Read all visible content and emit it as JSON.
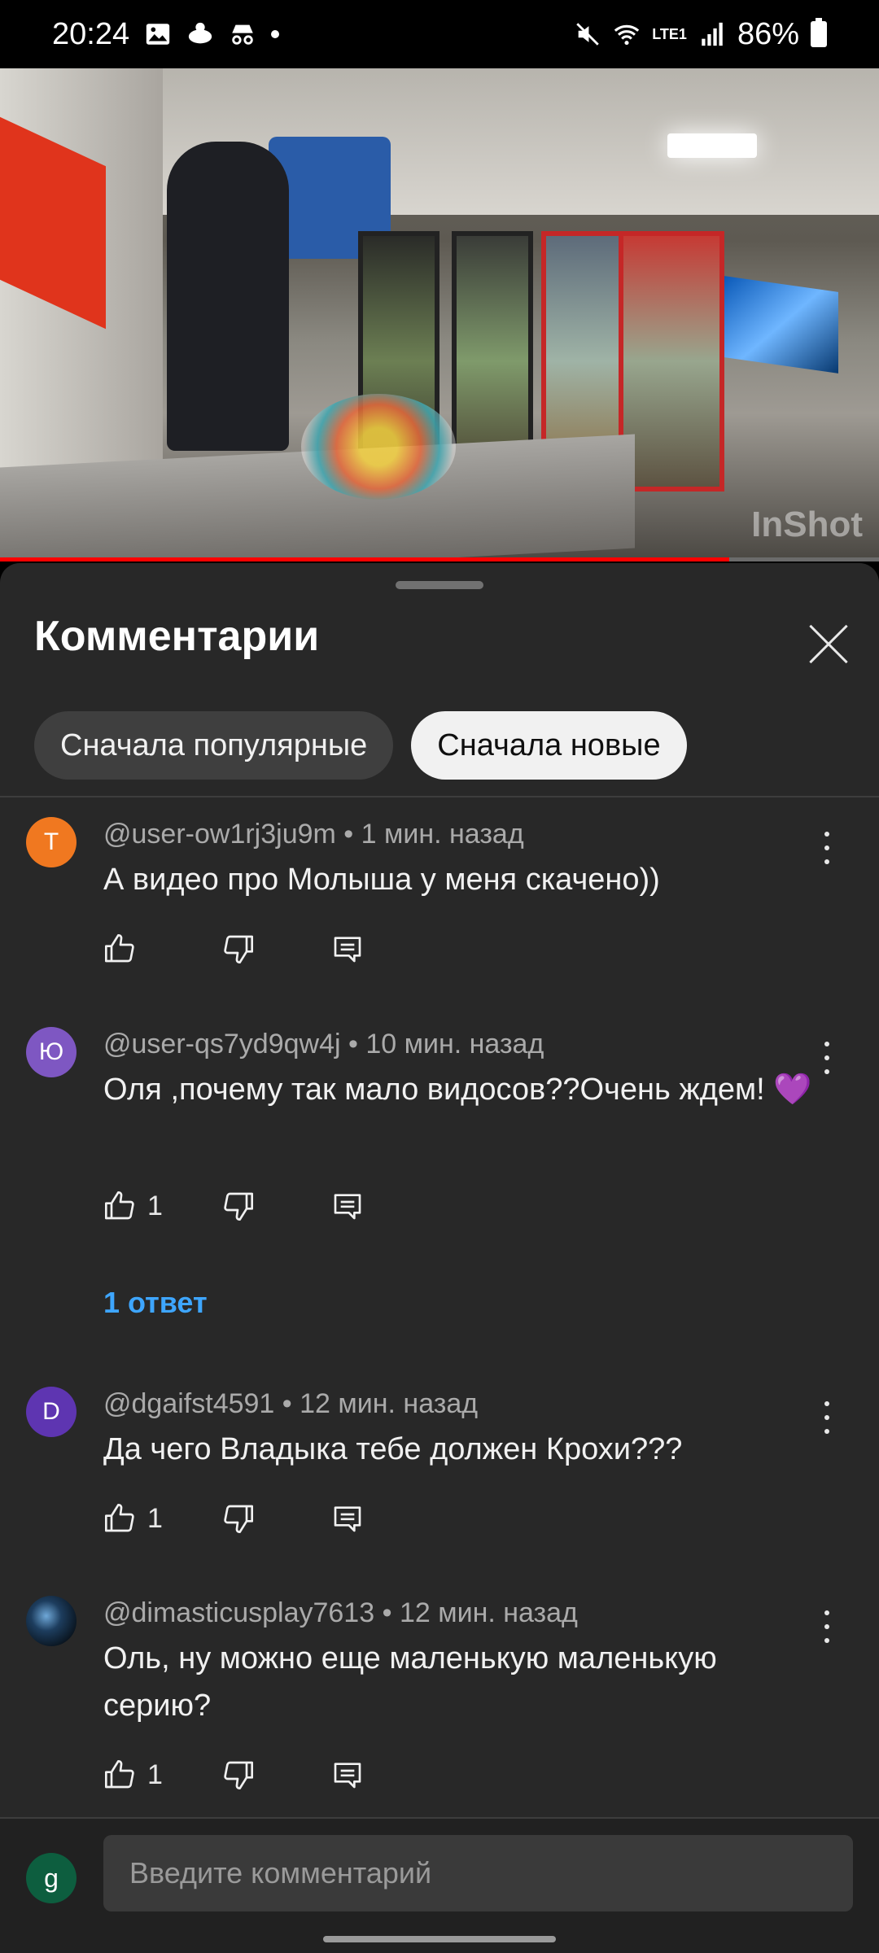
{
  "status_bar": {
    "time": "20:24",
    "battery": "86%",
    "network": "LTE1"
  },
  "video": {
    "watermark": "InShot",
    "progress_fraction": 0.83
  },
  "comments_panel": {
    "title": "Комментарии",
    "sort_chips": [
      {
        "label": "Сначала популярные",
        "selected": false
      },
      {
        "label": "Сначала новые",
        "selected": true
      }
    ],
    "comments": [
      {
        "avatar_letter": "T",
        "avatar_color": "#f07820",
        "author": "@user-ow1rj3ju9m",
        "time": "1 мин. назад",
        "text": "А видео про Молыша у меня скачено))",
        "likes": ""
      },
      {
        "avatar_letter": "Ю",
        "avatar_color": "#7e57c2",
        "author": "@user-qs7yd9qw4j",
        "time": "10 мин. назад",
        "text": "Оля ,почему так мало видосов??Очень ждем! 💜",
        "likes": "1",
        "replies_label": "1 ответ"
      },
      {
        "avatar_letter": "D",
        "avatar_color": "#5e35b1",
        "author": "@dgaifst4591",
        "time": "12 мин. назад",
        "text": "Да чего Владыка тебе должен Крохи???",
        "likes": "1"
      },
      {
        "avatar_letter": "",
        "avatar_color": "#1b2a3a",
        "author": "@dimasticusplay7613",
        "time": "12 мин. назад",
        "text": "Оль, ну можно еще маленькую маленькую серию?",
        "likes": "1"
      }
    ],
    "composer": {
      "avatar_letter": "g",
      "placeholder": "Введите комментарий"
    }
  }
}
